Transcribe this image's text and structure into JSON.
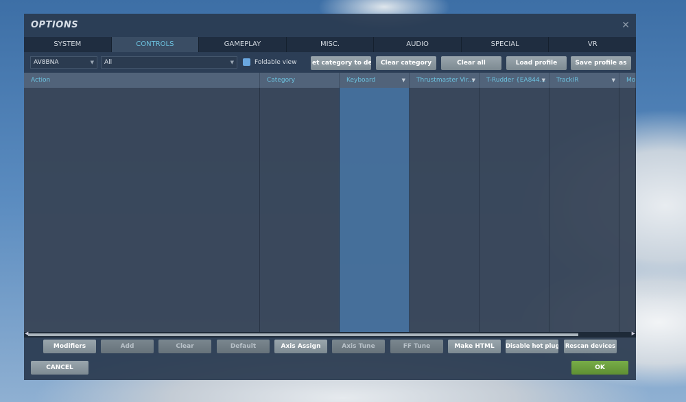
{
  "title": "OPTIONS",
  "tabs": [
    "SYSTEM",
    "CONTROLS",
    "GAMEPLAY",
    "MISC.",
    "AUDIO",
    "SPECIAL",
    "VR"
  ],
  "active_tab": "CONTROLS",
  "aircraft_select": "AV8BNA",
  "category_select": "All",
  "foldable_view": {
    "label": "Foldable view",
    "checked": true
  },
  "toolbar": [
    "set category to default",
    "Clear category",
    "Clear all",
    "Load profile",
    "Save profile as"
  ],
  "toolbar_visible_first": "et category to defa",
  "columns": [
    "Action",
    "Category",
    "Keyboard",
    "Thrustmaster Vir...",
    "T-Rudder {EA844...",
    "TrackIR",
    "Mou"
  ],
  "bottom_buttons": [
    {
      "label": "Modifiers",
      "enabled": true
    },
    {
      "label": "Add",
      "enabled": false
    },
    {
      "label": "Clear",
      "enabled": false
    },
    {
      "label": "Default",
      "enabled": false
    },
    {
      "label": "Axis Assign",
      "enabled": true
    },
    {
      "label": "Axis Tune",
      "enabled": false
    },
    {
      "label": "FF Tune",
      "enabled": false
    },
    {
      "label": "Make HTML",
      "enabled": true
    },
    {
      "label": "Disable hot plug",
      "enabled": true
    },
    {
      "label": "Rescan devices",
      "enabled": true
    }
  ],
  "cancel": "CANCEL",
  "ok": "OK",
  "colors": {
    "accent": "#6cc3e0",
    "ok": "#6a9a3c"
  }
}
